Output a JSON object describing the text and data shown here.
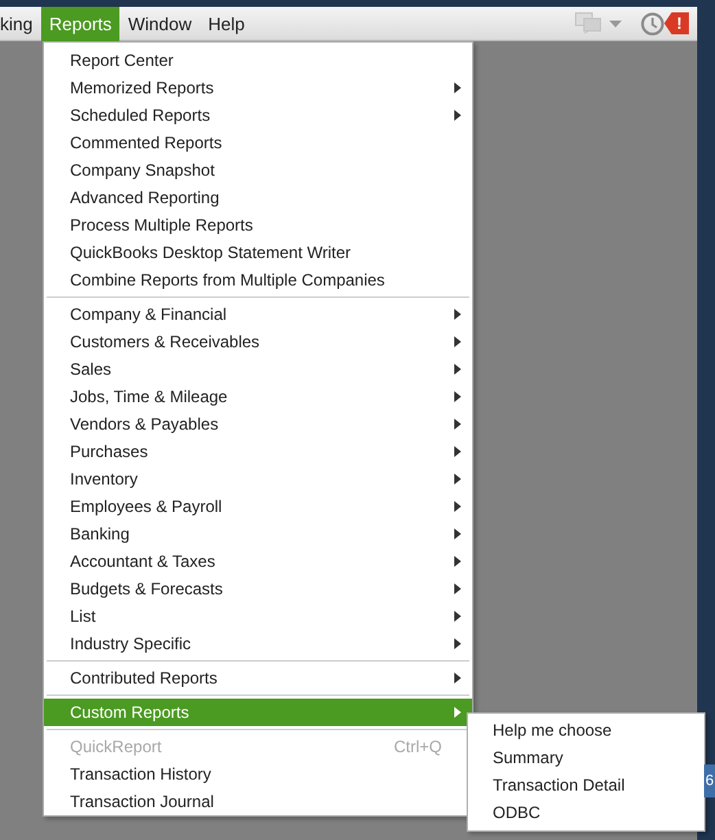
{
  "menu_bar": [
    {
      "label": "king",
      "selected": false
    },
    {
      "label": "Reports",
      "selected": true
    },
    {
      "label": "Window",
      "selected": false
    },
    {
      "label": "Help",
      "selected": false
    }
  ],
  "toolbar_badge": {
    "label": "!"
  },
  "reports_menu": [
    {
      "items": [
        {
          "label": "Report Center",
          "submenu": false,
          "selected": false,
          "disabled": false
        },
        {
          "label": "Memorized Reports",
          "submenu": true,
          "selected": false,
          "disabled": false
        },
        {
          "label": "Scheduled Reports",
          "submenu": true,
          "selected": false,
          "disabled": false
        },
        {
          "label": "Commented Reports",
          "submenu": false,
          "selected": false,
          "disabled": false
        },
        {
          "label": "Company Snapshot",
          "submenu": false,
          "selected": false,
          "disabled": false
        },
        {
          "label": "Advanced Reporting",
          "submenu": false,
          "selected": false,
          "disabled": false
        },
        {
          "label": "Process Multiple Reports",
          "submenu": false,
          "selected": false,
          "disabled": false
        },
        {
          "label": "QuickBooks Desktop Statement Writer",
          "submenu": false,
          "selected": false,
          "disabled": false
        },
        {
          "label": "Combine Reports from Multiple Companies",
          "submenu": false,
          "selected": false,
          "disabled": false
        }
      ]
    },
    {
      "items": [
        {
          "label": "Company & Financial",
          "submenu": true,
          "selected": false,
          "disabled": false
        },
        {
          "label": "Customers & Receivables",
          "submenu": true,
          "selected": false,
          "disabled": false
        },
        {
          "label": "Sales",
          "submenu": true,
          "selected": false,
          "disabled": false
        },
        {
          "label": "Jobs, Time & Mileage",
          "submenu": true,
          "selected": false,
          "disabled": false
        },
        {
          "label": "Vendors & Payables",
          "submenu": true,
          "selected": false,
          "disabled": false
        },
        {
          "label": "Purchases",
          "submenu": true,
          "selected": false,
          "disabled": false
        },
        {
          "label": "Inventory",
          "submenu": true,
          "selected": false,
          "disabled": false
        },
        {
          "label": "Employees & Payroll",
          "submenu": true,
          "selected": false,
          "disabled": false
        },
        {
          "label": "Banking",
          "submenu": true,
          "selected": false,
          "disabled": false
        },
        {
          "label": "Accountant & Taxes",
          "submenu": true,
          "selected": false,
          "disabled": false
        },
        {
          "label": "Budgets & Forecasts",
          "submenu": true,
          "selected": false,
          "disabled": false
        },
        {
          "label": "List",
          "submenu": true,
          "selected": false,
          "disabled": false
        },
        {
          "label": "Industry Specific",
          "submenu": true,
          "selected": false,
          "disabled": false
        }
      ]
    },
    {
      "items": [
        {
          "label": "Contributed Reports",
          "submenu": true,
          "selected": false,
          "disabled": false
        }
      ]
    },
    {
      "items": [
        {
          "label": "Custom Reports",
          "submenu": true,
          "selected": true,
          "disabled": false
        }
      ]
    },
    {
      "items": [
        {
          "label": "QuickReport",
          "shortcut": "Ctrl+Q",
          "submenu": false,
          "selected": false,
          "disabled": true
        },
        {
          "label": "Transaction History",
          "submenu": false,
          "selected": false,
          "disabled": false
        },
        {
          "label": "Transaction Journal",
          "submenu": false,
          "selected": false,
          "disabled": false
        }
      ]
    }
  ],
  "custom_reports_submenu": [
    {
      "label": "Help me choose"
    },
    {
      "label": "Summary"
    },
    {
      "label": "Transaction Detail"
    },
    {
      "label": "ODBC"
    }
  ],
  "edge_tab": {
    "label": "6"
  }
}
